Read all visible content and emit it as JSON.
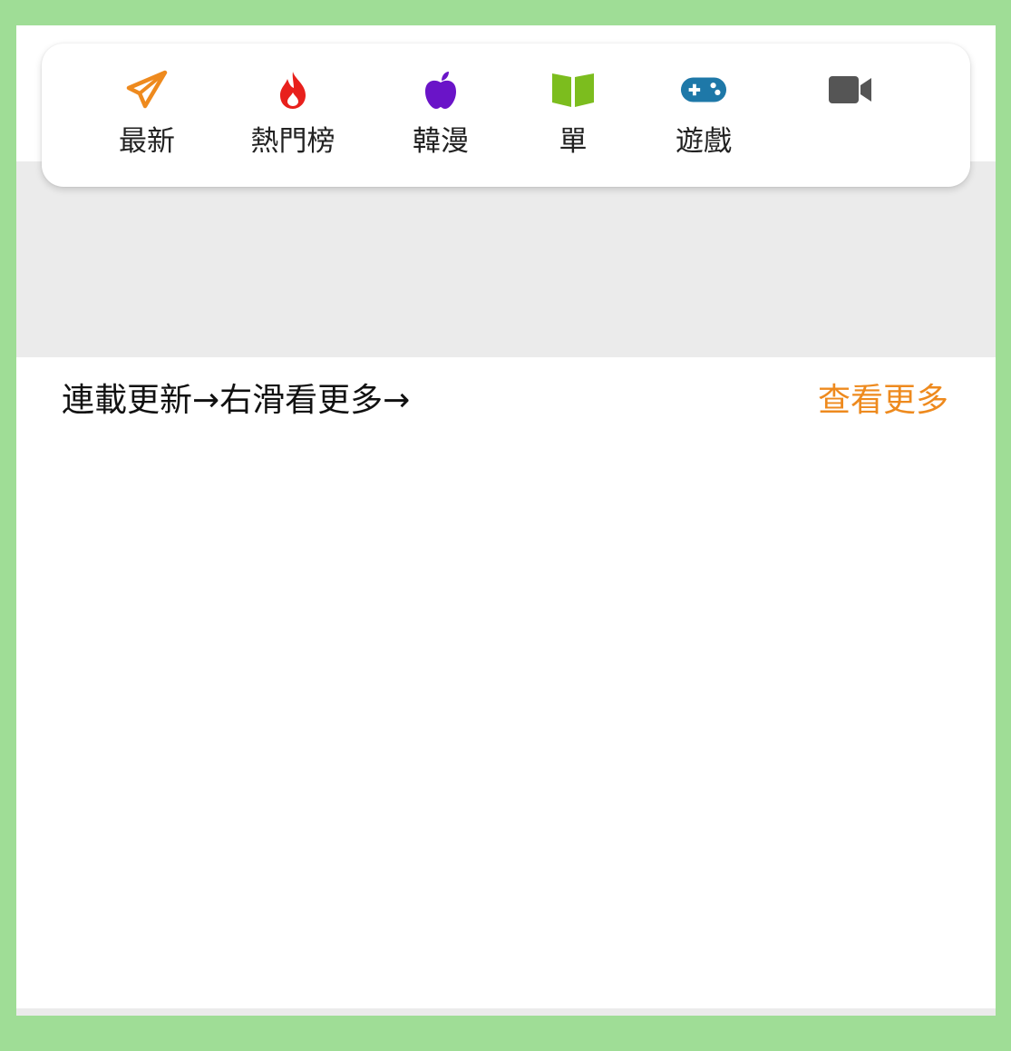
{
  "colors": {
    "accent_orange": "#ee8a1e",
    "fire_red": "#e8201c",
    "apple_purple": "#6a14c8",
    "book_green": "#7cbd1e",
    "gamepad_blue": "#1e78a8",
    "video_gray": "#555555",
    "page_green": "#9fdd96"
  },
  "nav": {
    "items": [
      {
        "label": "最新",
        "icon": "paper-plane-icon"
      },
      {
        "label": "熱門榜",
        "icon": "fire-icon"
      },
      {
        "label": "韓漫",
        "icon": "apple-icon"
      },
      {
        "label": "單",
        "icon": "open-book-icon"
      },
      {
        "label": "遊戲",
        "icon": "gamepad-icon"
      },
      {
        "label": "",
        "icon": "video-camera-icon"
      }
    ]
  },
  "section": {
    "title": "連載更新→右滑看更多→",
    "more_label": "查看更多"
  }
}
